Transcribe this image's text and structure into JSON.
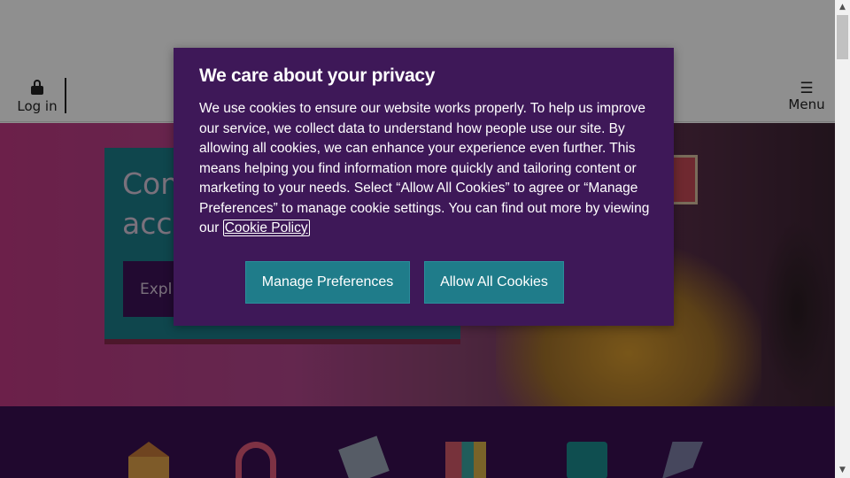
{
  "header": {
    "login_label": "Log in",
    "menu_label": "Menu",
    "menu_icon": "hamburger-icon",
    "login_icon": "lock-icon"
  },
  "hero": {
    "title_line1": "Con",
    "title_line2": "acc",
    "explore_label": "Expl"
  },
  "cookie_modal": {
    "title": "We care about your privacy",
    "body": "We use cookies to ensure our website works properly. To help us improve our service, we collect data to understand how people use our site. By allowing all cookies, we can enhance your experience even further. This means helping you find information more quickly and tailoring content or marketing to your needs. Select “Allow All Cookies” to agree or “Manage Preferences” to manage cookie settings. You can find out more by viewing our ",
    "policy_link": "Cookie Policy",
    "manage_button": "Manage Preferences",
    "allow_button": "Allow All Cookies"
  },
  "colors": {
    "modal_bg": "#3e1858",
    "button_bg": "#1f7c8a",
    "band_bg": "#3a0f52",
    "hero_card_bg": "#1b7d8a"
  }
}
